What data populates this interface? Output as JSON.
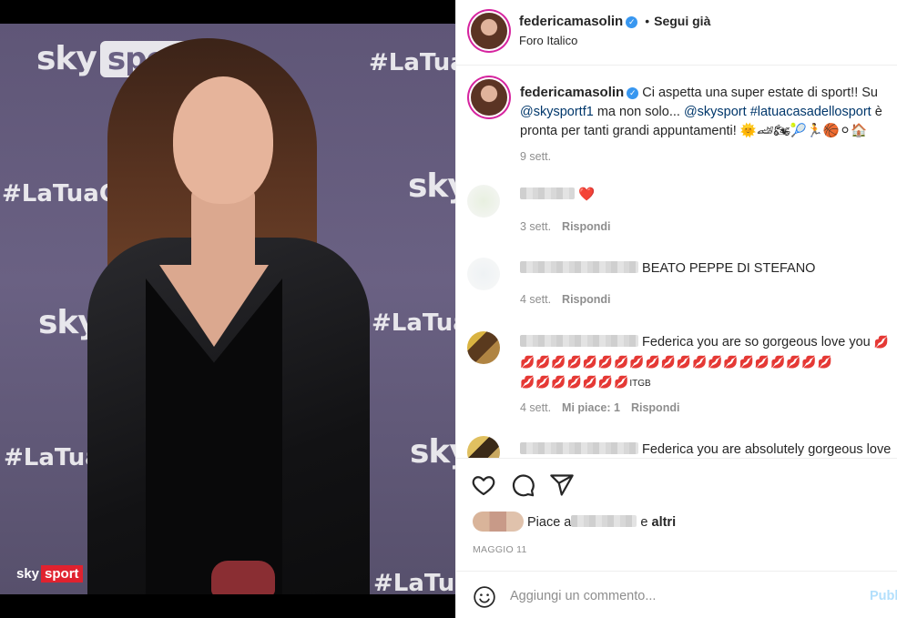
{
  "header": {
    "username": "federicamasolin",
    "follow_status": "Segui già",
    "separator": "•",
    "location": "Foro Italico"
  },
  "photo": {
    "watermarks": {
      "sky": "sky",
      "sport": "sport",
      "hashtag": "#LaTuaCasa",
      "hashtag_short": "#LaTua",
      "corner_sky": "sky",
      "corner_sport": "sport"
    }
  },
  "caption": {
    "username": "federicamasolin",
    "text_1": "Ci aspetta una super estate di sport!! Su",
    "mention_1": "@skysportf1",
    "text_2": "ma non solo...",
    "mention_2": "@skysport",
    "hashtag": "#latuacasadellosport",
    "text_3": "è pronta per tanti grandi appuntamenti!",
    "emojis": "🌞🏎🏍🎾🏃🏀⚪🏠",
    "time": "9 sett."
  },
  "comments": [
    {
      "emoji": "❤️",
      "time": "3 sett.",
      "reply": "Rispondi"
    },
    {
      "text": "BEATO PEPPE DI STEFANO",
      "time": "4 sett.",
      "reply": "Rispondi"
    },
    {
      "text": "Federica you are so gorgeous love you",
      "lips_row": "💋💋💋💋💋💋💋💋💋💋💋💋💋💋💋💋💋💋💋💋",
      "lips_row2": "💋💋💋💋💋💋💋",
      "tag": "ITGB",
      "time": "4 sett.",
      "likes": "Mi piace: 1",
      "reply": "Rispondi"
    },
    {
      "text": "Federica you are absolutely gorgeous love"
    }
  ],
  "actions": {
    "likes_prefix": "Piace a",
    "likes_and": "e",
    "likes_others": "altri",
    "date": "MAGGIO 11"
  },
  "add_comment": {
    "placeholder": "Aggiungi un commento...",
    "post": "Pubb"
  },
  "colors": {
    "link": "#00376b",
    "verified": "#3897f0",
    "muted": "#8e8e8e",
    "post_disabled": "#b2dffc",
    "heart": "#ed4956"
  }
}
